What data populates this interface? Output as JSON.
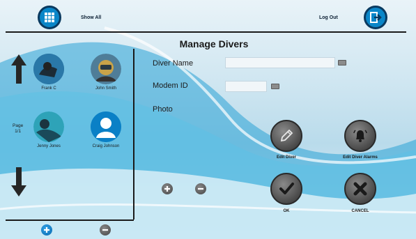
{
  "topbar": {
    "show_all": "Show All",
    "log_out": "Log Out"
  },
  "title": "Manage Divers",
  "form": {
    "diver_name_label": "Diver Name",
    "diver_name_value": "",
    "modem_id_label": "Modem ID",
    "modem_id_value": "",
    "photo_label": "Photo"
  },
  "divers": [
    {
      "name": "Frank C"
    },
    {
      "name": "John Smith"
    },
    {
      "name": "Jenny Jones"
    },
    {
      "name": "Craig Johnson"
    }
  ],
  "pager": {
    "line1": "Page",
    "line2": "1/1"
  },
  "actions": {
    "edit_diver": "Edit Diver",
    "edit_alarms": "Edit Diver Alarms",
    "ok": "OK",
    "cancel": "CANCEL"
  },
  "colors": {
    "accent": "#0a86c8",
    "dark": "#1a1a1a",
    "button_gray": "#4a4a4a"
  },
  "icons": [
    "grid-icon",
    "logout-icon",
    "keyboard-icon",
    "pencil-icon",
    "bell-icon",
    "check-icon",
    "x-icon",
    "plus-icon",
    "minus-icon",
    "arrow-up-icon",
    "arrow-down-icon",
    "user-icon"
  ]
}
